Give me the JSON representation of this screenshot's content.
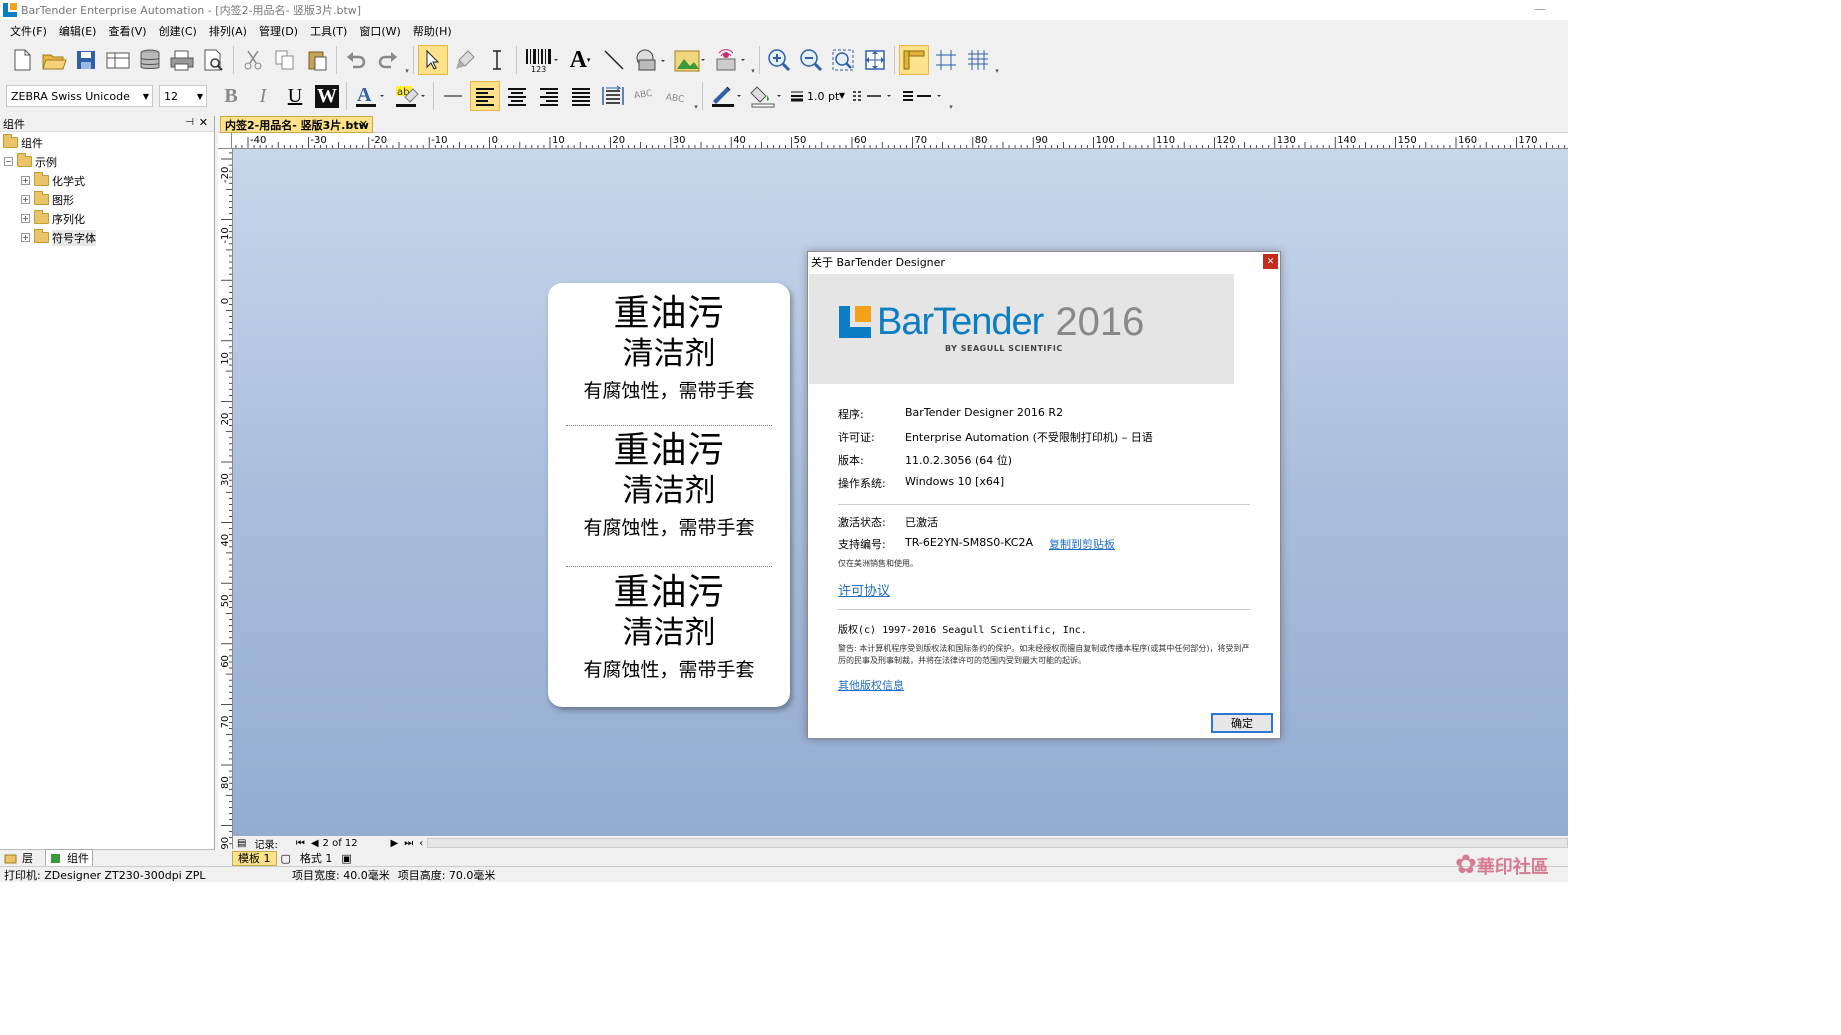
{
  "window": {
    "title": "BarTender Enterprise Automation - [内签2-用品名- 竖版3片.btw]"
  },
  "menu": [
    "文件(F)",
    "编辑(E)",
    "查看(V)",
    "创建(C)",
    "排列(A)",
    "管理(D)",
    "工具(T)",
    "窗口(W)",
    "帮助(H)"
  ],
  "toolbar": {
    "font_name": "ZEBRA Swiss Unicode",
    "font_size": "12",
    "line_width": "1.0 pt",
    "bold": "B",
    "italic": "I",
    "underline": "U",
    "wordart": "W",
    "text_tool": "A",
    "barcode_num": "123"
  },
  "left_panel": {
    "title": "组件",
    "tree": {
      "root": "组件",
      "folder": "示例",
      "children": [
        "化学式",
        "图形",
        "序列化",
        "符号字体"
      ]
    },
    "tabs": [
      "层",
      "组件"
    ]
  },
  "document": {
    "tab": "内签2-用品名- 竖版3片.btw",
    "hruler_labels": [
      "-40",
      "-30",
      "-20",
      "-10",
      "0",
      "10",
      "20",
      "30",
      "40",
      "50",
      "60",
      "70",
      "80",
      "90",
      "100",
      "110",
      "120",
      "130",
      "140",
      "150",
      "160",
      "170"
    ],
    "vruler_labels": [
      "-20",
      "-10",
      "0",
      "10",
      "20",
      "30",
      "40",
      "50",
      "60",
      "70",
      "80",
      "90"
    ],
    "label_blocks": [
      {
        "line1": "重油污",
        "line2": "清洁剂",
        "line3": "有腐蚀性，需带手套"
      },
      {
        "line1": "重油污",
        "line2": "清洁剂",
        "line3": "有腐蚀性，需带手套"
      },
      {
        "line1": "重油污",
        "line2": "清洁剂",
        "line3": "有腐蚀性，需带手套"
      }
    ],
    "record_label": "记录:",
    "record_value": "2 of 12",
    "sheets": [
      "模板 1",
      "格式 1"
    ]
  },
  "status": {
    "printer": "打印机: ZDesigner ZT230-300dpi ZPL",
    "item_width": "项目宽度: 40.0毫米",
    "item_height": "项目高度: 70.0毫米"
  },
  "about": {
    "title": "关于 BarTender Designer",
    "brand": "BarTender",
    "brand_year": "2016",
    "brand_by": "BY SEAGULL SCIENTIFIC",
    "rows": [
      {
        "k": "程序:",
        "v": "BarTender Designer 2016 R2"
      },
      {
        "k": "许可证:",
        "v": "Enterprise Automation (不受限制打印机) – 日语"
      },
      {
        "k": "版本:",
        "v": "11.0.2.3056 (64 位)"
      },
      {
        "k": "操作系统:",
        "v": "Windows 10 [x64]"
      }
    ],
    "activation_k": "激活状态:",
    "activation_v": "已激活",
    "support_k": "支持编号:",
    "support_v": "TR-6E2YN-SM8S0-KC2A",
    "copy_link": "复制到剪贴板",
    "region_note": "仅在美洲销售和使用。",
    "license_link": "许可协议",
    "copyright": "版权(c) 1997-2016 Seagull Scientific, Inc.",
    "warning": "警告: 本计算机程序受到版权法和国际条约的保护。如未经授权而擅自复制或传播本程序(或其中任何部分)，将受到严厉的民事及刑事制裁，并将在法律许可的范围内受到最大可能的起诉。",
    "other_link": "其他版权信息",
    "ok": "确定"
  },
  "watermark": "華印社區",
  "colors": {
    "accent": "#0b7dc2",
    "brand_orange": "#f3a21a",
    "selection": "#fde28a",
    "link": "#1f6fc5"
  }
}
